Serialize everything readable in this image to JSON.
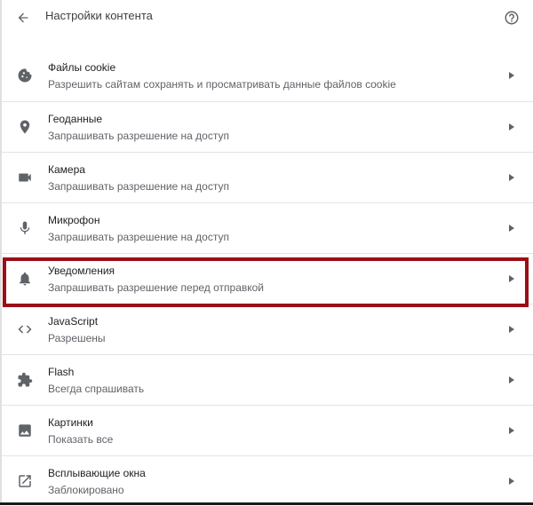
{
  "header": {
    "title": "Настройки контента",
    "back_icon": "arrow-back-icon",
    "help_icon": "help-circle-icon"
  },
  "items": [
    {
      "id": "cookies",
      "icon": "cookie-icon",
      "title": "Файлы cookie",
      "subtitle": "Разрешить сайтам сохранять и просматривать данные файлов cookie"
    },
    {
      "id": "location",
      "icon": "location-pin-icon",
      "title": "Геоданные",
      "subtitle": "Запрашивать разрешение на доступ"
    },
    {
      "id": "camera",
      "icon": "videocam-icon",
      "title": "Камера",
      "subtitle": "Запрашивать разрешение на доступ"
    },
    {
      "id": "microphone",
      "icon": "microphone-icon",
      "title": "Микрофон",
      "subtitle": "Запрашивать разрешение на доступ"
    },
    {
      "id": "notifications",
      "icon": "bell-icon",
      "title": "Уведомления",
      "subtitle": "Запрашивать разрешение перед отправкой"
    },
    {
      "id": "javascript",
      "icon": "code-icon",
      "title": "JavaScript",
      "subtitle": "Разрешены"
    },
    {
      "id": "flash",
      "icon": "puzzle-piece-icon",
      "title": "Flash",
      "subtitle": "Всегда спрашивать"
    },
    {
      "id": "images",
      "icon": "image-icon",
      "title": "Картинки",
      "subtitle": "Показать все"
    },
    {
      "id": "popups",
      "icon": "open-in-new-icon",
      "title": "Всплывающие окна",
      "subtitle": "Заблокировано"
    }
  ],
  "highlighted_item": "notifications",
  "colors": {
    "highlight": "#9b0f17",
    "icon": "#5f6368",
    "divider": "#e4e4e4"
  }
}
